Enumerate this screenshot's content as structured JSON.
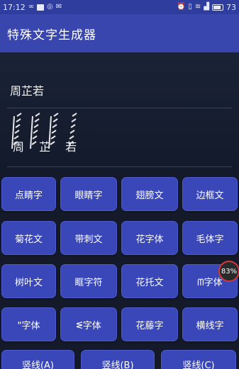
{
  "status_bar": {
    "time": "17:12",
    "left_icons": [
      "infinity-icon",
      "app-notification-icon",
      "check-circle-icon",
      "mail-icon"
    ],
    "right_icons": [
      "alarm-icon",
      "vibrate-icon",
      "wifi-icon",
      "signal-icon",
      "battery-icon"
    ],
    "battery_level": "73"
  },
  "app_bar": {
    "title": "特殊文字生成器"
  },
  "input": {
    "value": "周芷若"
  },
  "output": {
    "value": "周 芷 若"
  },
  "buttons": {
    "row1": [
      "点睛字",
      "眼睛字",
      "翅膀文",
      "边框文"
    ],
    "row2": [
      "菊花文",
      "带刺文",
      "花字体",
      "毛体字"
    ],
    "row3": [
      "树叶文",
      "眶字符",
      "花托文",
      "ᗰ字体"
    ],
    "row4": [
      "\"字体",
      "ᓬ字体",
      "花藤字",
      "横线字"
    ],
    "row5": [
      "竖线(A)",
      "竖线(B)",
      "竖线(C)"
    ]
  },
  "overlay_badge": {
    "value": "83%"
  },
  "colors": {
    "app_bar": "#3946ad",
    "status_bar": "#2f3d9e",
    "button": "#3a47b8",
    "background": "#141a2a",
    "badge_ring": "#d23a3a"
  }
}
